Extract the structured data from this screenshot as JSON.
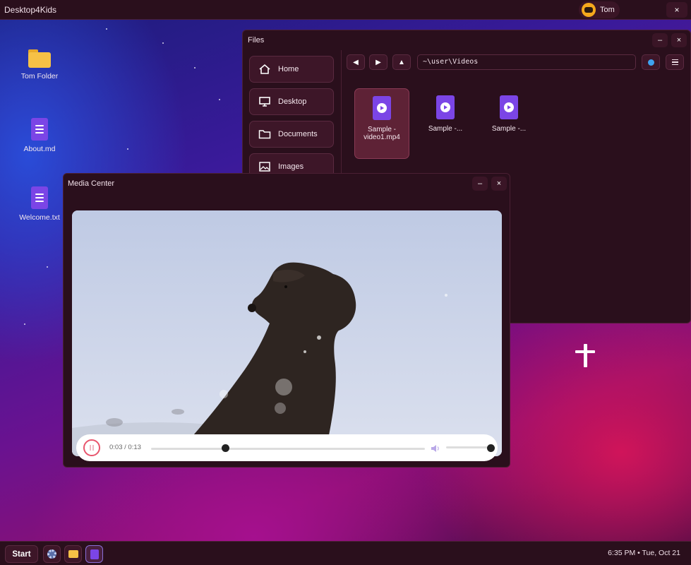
{
  "topbar": {
    "brand": "Desktop4Kids",
    "user": "Tom",
    "close": "×"
  },
  "desktop_icons": [
    {
      "label": "Tom Folder",
      "icon": "folder-icon"
    },
    {
      "label": "About.md",
      "icon": "document-icon"
    },
    {
      "label": "Welcome.txt",
      "icon": "document-icon"
    }
  ],
  "files_window": {
    "title": "Files",
    "minimize": "–",
    "close": "×",
    "sidebar": [
      {
        "label": "Home",
        "icon": "home-icon"
      },
      {
        "label": "Desktop",
        "icon": "monitor-icon"
      },
      {
        "label": "Documents",
        "icon": "folder-icon"
      },
      {
        "label": "Images",
        "icon": "image-icon"
      }
    ],
    "nav": {
      "back": "◀",
      "forward": "▶",
      "up": "▲"
    },
    "path": "~\\user\\Videos",
    "files": [
      {
        "name": "Sample - video1.mp4",
        "selected": true
      },
      {
        "name": "Sample -...",
        "selected": false
      },
      {
        "name": "Sample -...",
        "selected": false
      }
    ]
  },
  "media_window": {
    "title": "Media Center",
    "minimize": "–",
    "close": "×",
    "time": "0:03 / 0:13",
    "progress": 0.27,
    "volume": 1.0
  },
  "taskbar": {
    "start": "Start",
    "clock": "6:35 PM • Tue, Oct 21"
  },
  "colors": {
    "accent": "#7b45e6",
    "window_bg": "#2a0f1c",
    "pause_ring": "#e8556d"
  }
}
